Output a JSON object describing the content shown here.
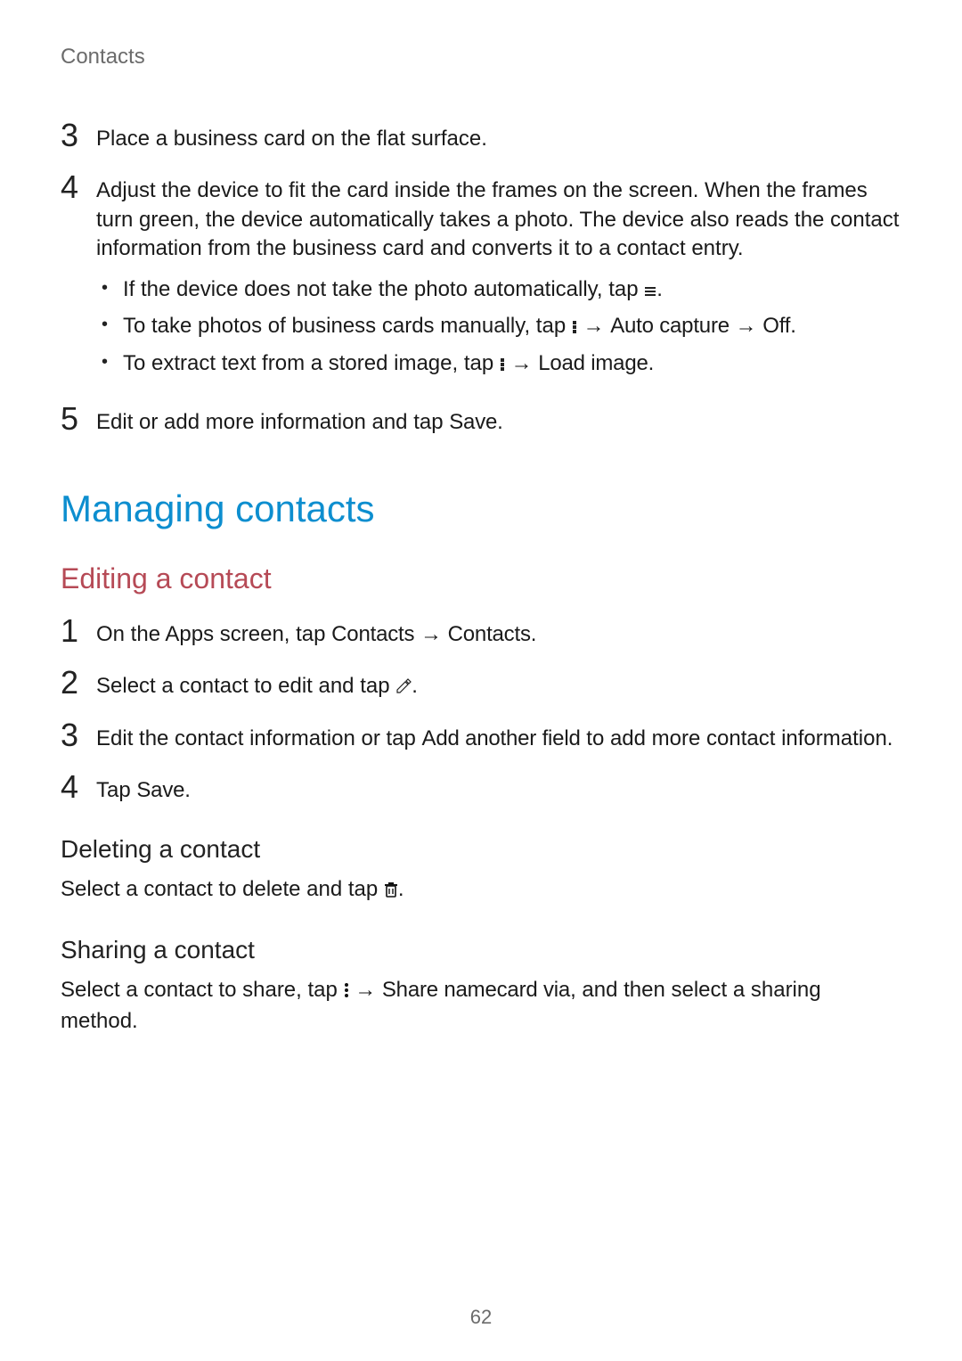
{
  "header": "Contacts",
  "top_steps": {
    "s3": "Place a business card on the flat surface.",
    "s4_main": "Adjust the device to fit the card inside the frames on the screen. When the frames turn green, the device automatically takes a photo. The device also reads the contact information from the business card and converts it to a contact entry.",
    "s4_bullets": {
      "b1_a": "If the device does not take the photo automatically, tap ",
      "b1_b": ".",
      "b2_a": "To take photos of business cards manually, tap ",
      "b2_b": " → ",
      "b2_c": "Auto capture",
      "b2_d": " → ",
      "b2_e": "Off",
      "b2_f": ".",
      "b3_a": "To extract text from a stored image, tap ",
      "b3_b": " → ",
      "b3_c": "Load image",
      "b3_d": "."
    },
    "s5_a": "Edit or add more information and tap ",
    "s5_b": "Save",
    "s5_c": "."
  },
  "section_title": "Managing contacts",
  "editing": {
    "title": "Editing a contact",
    "s1_a": "On the Apps screen, tap ",
    "s1_b": "Contacts",
    "s1_c": " → ",
    "s1_d": "Contacts",
    "s1_e": ".",
    "s2_a": "Select a contact to edit and tap ",
    "s2_b": ".",
    "s3_a": "Edit the contact information or tap ",
    "s3_b": "Add another field",
    "s3_c": " to add more contact information.",
    "s4_a": "Tap ",
    "s4_b": "Save",
    "s4_c": "."
  },
  "deleting": {
    "title": "Deleting a contact",
    "body_a": "Select a contact to delete and tap ",
    "body_b": "."
  },
  "sharing": {
    "title": "Sharing a contact",
    "body_a": "Select a contact to share, tap ",
    "body_b": " → ",
    "body_c": "Share namecard via",
    "body_d": ", and then select a sharing method."
  },
  "page_number": "62"
}
